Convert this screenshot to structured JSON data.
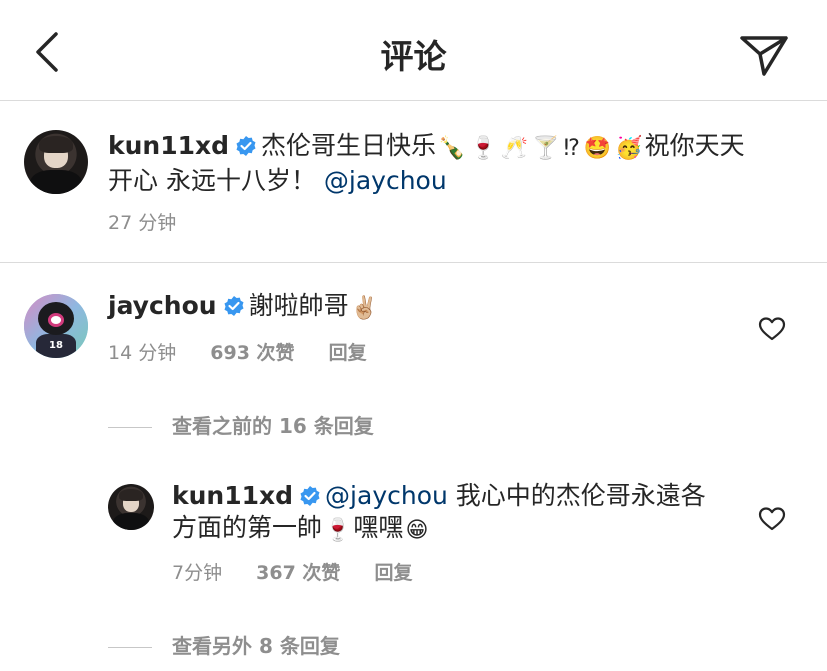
{
  "header": {
    "title": "评论"
  },
  "post": {
    "username": "kun11xd",
    "text_a": "杰伦哥生日快乐",
    "emojis_a": [
      "🍾",
      "🍷",
      "🥂",
      "🍸",
      "⁉",
      "🤩",
      "🥳"
    ],
    "text_b": "祝你天天",
    "text_c": "开心 永远十八岁！",
    "mention": "@jaychou",
    "time": "27 分钟"
  },
  "comment1": {
    "username": "jaychou",
    "text": "謝啦帥哥",
    "emoji": "✌🏼",
    "time": "14 分钟",
    "likes": "693 次赞",
    "reply": "回复"
  },
  "view_prev": "查看之前的 16 条回复",
  "reply1": {
    "username": "kun11xd",
    "mention": "@jaychou",
    "text_a": "我心中的杰伦哥永遠各",
    "text_b": "方面的第一帥",
    "emoji_a": "🍷",
    "text_c": "嘿嘿",
    "emoji_b": "😁",
    "time": "7分钟",
    "likes": "367 次赞",
    "reply": "回复"
  },
  "view_more": "查看另外 8 条回复"
}
